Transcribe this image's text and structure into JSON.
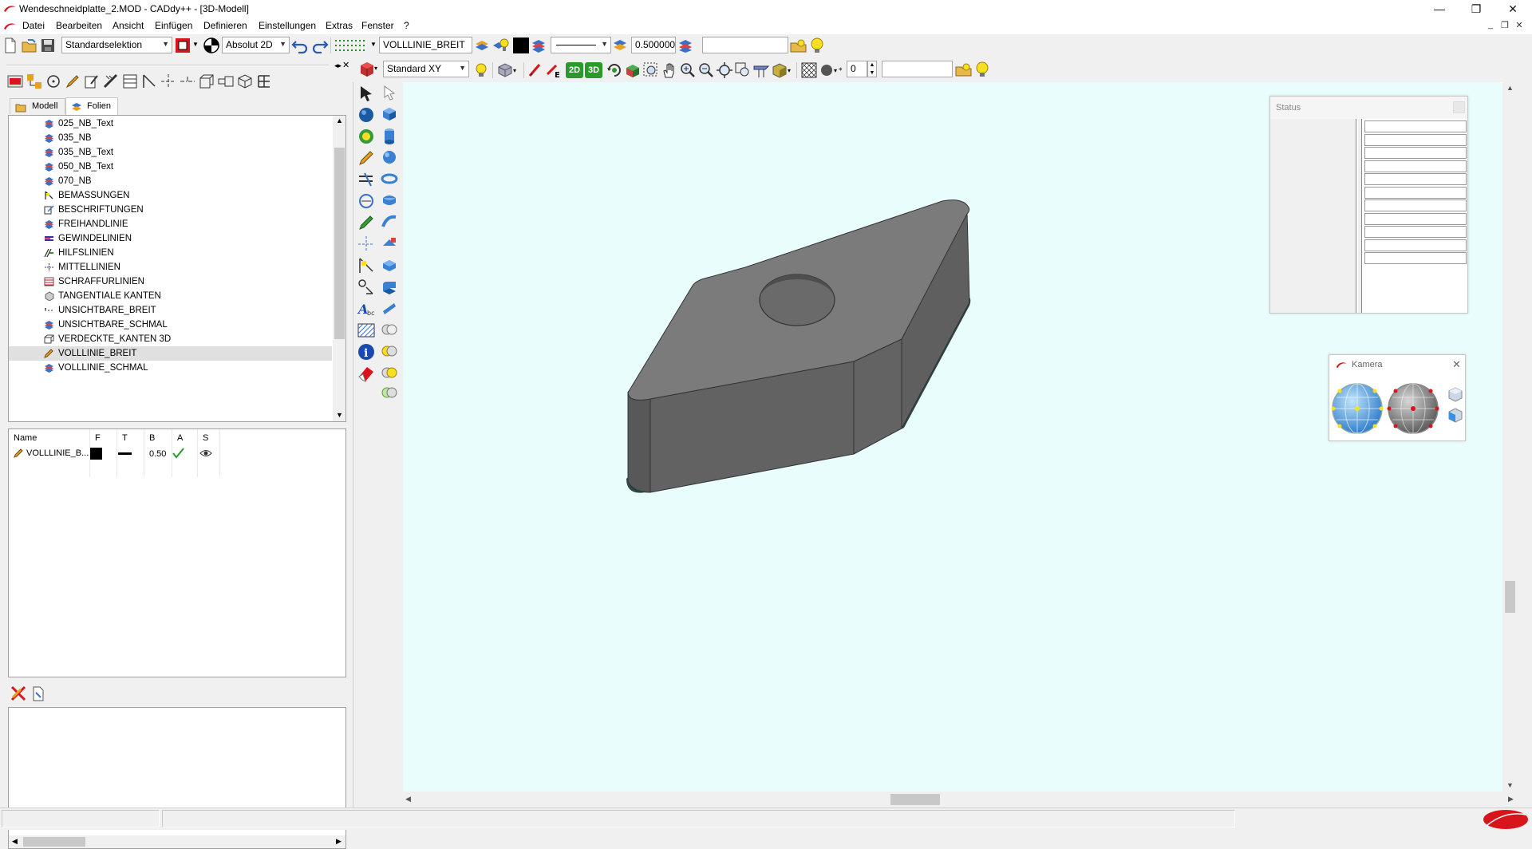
{
  "window": {
    "title": "Wendeschneidplatte_2.MOD  -  CADdy++ - [3D-Modell]",
    "controls": {
      "minimize": "—",
      "restore": "❐",
      "close": "✕"
    },
    "mdi_controls": {
      "minimize": "_",
      "restore": "❐",
      "close": "✕"
    }
  },
  "menu": [
    "Datei",
    "Bearbeiten",
    "Ansicht",
    "Einfügen",
    "Definieren",
    "Einstellungen",
    "Extras",
    "Fenster",
    "?"
  ],
  "toolbar1": {
    "selection_mode": "Standardselektion",
    "coord_mode": "Absolut 2D",
    "layer_name": "VOLLLINIE_BREIT",
    "line_width": "0.500000",
    "search_value": ""
  },
  "toolbar2": {
    "view_mode": "Standard XY",
    "view_2d": "2D",
    "view_3d": "3D",
    "counter": "0",
    "search_value": ""
  },
  "left_tabs": {
    "model": "Modell",
    "layers": "Folien"
  },
  "layer_tree": [
    {
      "label": "025_NB_Text",
      "icon": "layer-stack-icon"
    },
    {
      "label": "035_NB",
      "icon": "layer-stack-icon"
    },
    {
      "label": "035_NB_Text",
      "icon": "layer-stack-icon"
    },
    {
      "label": "050_NB_Text",
      "icon": "layer-stack-icon"
    },
    {
      "label": "070_NB",
      "icon": "layer-stack-icon"
    },
    {
      "label": "BEMASSUNGEN",
      "icon": "dimension-icon"
    },
    {
      "label": "BESCHRIFTUNGEN",
      "icon": "annotation-icon"
    },
    {
      "label": "FREIHANDLINIE",
      "icon": "layer-stack-icon"
    },
    {
      "label": "GEWINDELINIEN",
      "icon": "thread-line-icon"
    },
    {
      "label": "HILFSLINIEN",
      "icon": "helper-line-icon"
    },
    {
      "label": "MITTELLINIEN",
      "icon": "center-line-icon"
    },
    {
      "label": "SCHRAFFURLINIEN",
      "icon": "hatch-icon"
    },
    {
      "label": "TANGENTIALE KANTEN",
      "icon": "tangent-edge-icon"
    },
    {
      "label": "UNSICHTBARE_BREIT",
      "icon": "hidden-line-icon"
    },
    {
      "label": "UNSICHTBARE_SCHMAL",
      "icon": "layer-stack-icon"
    },
    {
      "label": "VERDECKTE_KANTEN 3D",
      "icon": "hidden-edge-3d-icon"
    },
    {
      "label": "VOLLLINIE_BREIT",
      "icon": "pencil-icon",
      "selected": true
    },
    {
      "label": "VOLLLINIE_SCHMAL",
      "icon": "layer-stack-icon"
    }
  ],
  "props_table": {
    "headers": [
      "Name",
      "F",
      "T",
      "B",
      "A",
      "S"
    ],
    "row": {
      "name": "VOLLLINIE_B...",
      "width": "0.50"
    }
  },
  "status_window": {
    "title": "Status",
    "rows": 11
  },
  "camera_window": {
    "title": "Kamera"
  },
  "colors": {
    "viewport_bg": "#e9fdfd",
    "model_top": "#7b7b7b",
    "model_side": "#5e5e5e",
    "brand_red": "#d8141c"
  }
}
